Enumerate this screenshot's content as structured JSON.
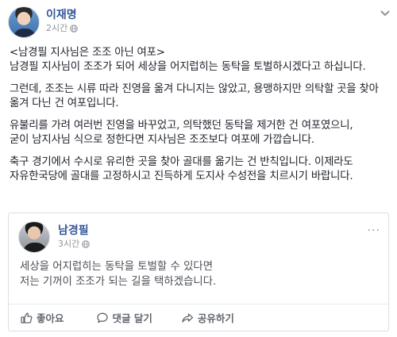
{
  "post": {
    "author": "이재명",
    "time": "2시간",
    "body": [
      [
        "<남경필 지사님은 조조 아닌 여포>",
        "남경필 지사님이 조조가 되어 세상을 어지럽히는 동탁을 토벌하시겠다고 하십니다."
      ],
      [
        "그런데, 조조는 시류 따라 진영을 옮겨 다니지는 않았고, 용맹하지만 의탁할 곳을 찾아 옮겨 다닌 건 여포입니다."
      ],
      [
        "유불리를 가려 여러번 진영을 바꾸었고, 의탁했던 동탁을 제거한 건 여포였으니,",
        "굳이 남지사님 식으로 정한다면 지사님은 조조보다 여포에 가깝습니다."
      ],
      [
        "축구 경기에서 수시로 유리한 곳을 찾아 골대를 옮기는 건 반칙입니다. 이제라도",
        "자유한국당에 골대를 고정하시고 진득하게 도지사 수성전을 치르시기 바랍니다."
      ]
    ]
  },
  "shared": {
    "author": "남경필",
    "time": "3시간",
    "dots": "···",
    "lines": [
      "세상을 어지럽히는 동탁을 토벌할 수 있다면",
      "저는 기꺼이 조조가 되는 길을 택하겠습니다."
    ],
    "actions": {
      "like": "좋아요",
      "comment": "댓글 달기",
      "share": "공유하기"
    }
  }
}
